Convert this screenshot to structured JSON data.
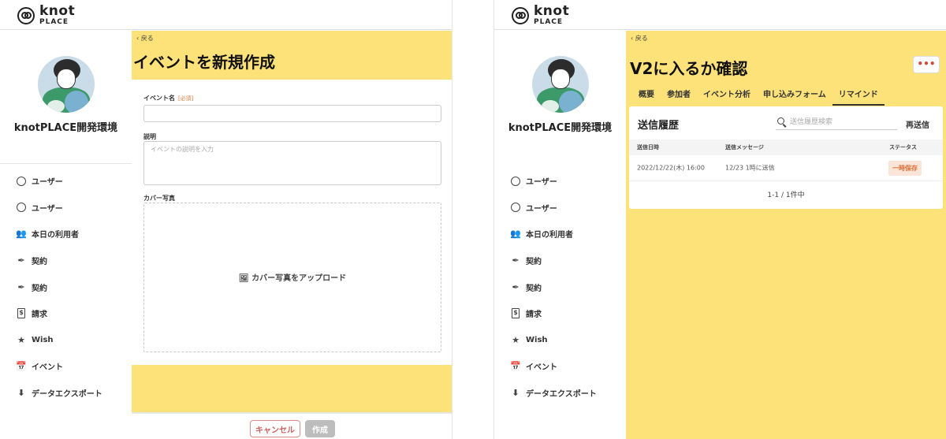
{
  "brand": {
    "line1": "knot",
    "line2": "PLACE"
  },
  "org_name": "knotPLACE開発環境",
  "sidebar": {
    "items": [
      {
        "label": "ユーザー",
        "icon": "face-icon"
      },
      {
        "label": "ユーザー",
        "icon": "face-icon"
      },
      {
        "label": "本日の利用者",
        "icon": "people-icon"
      },
      {
        "label": "契約",
        "icon": "pen-icon"
      },
      {
        "label": "契約",
        "icon": "pen-icon"
      },
      {
        "label": "請求",
        "icon": "dollar-doc-icon"
      },
      {
        "label": "Wish",
        "icon": "star-icon"
      },
      {
        "label": "イベント",
        "icon": "calendar-icon"
      },
      {
        "label": "データエクスポート",
        "icon": "download-icon"
      }
    ]
  },
  "left": {
    "back": "戻る",
    "title": "イベントを新規作成",
    "event_name_label": "イベント名",
    "required": "[必須]",
    "event_name_value": "",
    "description_label": "説明",
    "description_placeholder": "イベントの説明を入力",
    "cover_label": "カバー写真",
    "upload_label": "カバー写真をアップロード",
    "cancel": "キャンセル",
    "create": "作成"
  },
  "right": {
    "back": "戻る",
    "title": "V2に入るか確認",
    "more": "•••",
    "tabs": [
      "概要",
      "参加者",
      "イベント分析",
      "申し込みフォーム",
      "リマインド"
    ],
    "active_tab": "リマインド",
    "card_title": "送信履歴",
    "search_placeholder": "送信履歴検索",
    "resend": "再送信",
    "columns": [
      "送信日時",
      "送信メッセージ",
      "ステータス"
    ],
    "rows": [
      {
        "date": "2022/12/22(木) 16:00",
        "message": "12/23 1時に送信",
        "status": "一時保存"
      }
    ],
    "pager": "1-1 / 1件中"
  },
  "colors": {
    "accent_yellow": "#fde27a",
    "status_orange": "#e0703a",
    "danger": "#d06060"
  }
}
